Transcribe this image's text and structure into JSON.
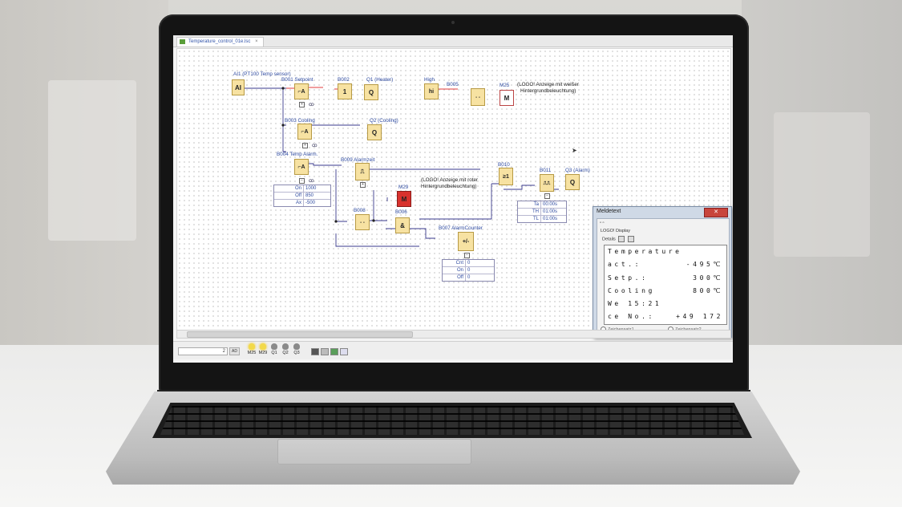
{
  "document_tab": {
    "title": "Temperature_control_01e.lsc",
    "close": "×"
  },
  "blocks": [
    {
      "id": "AI1",
      "glyph": "AI",
      "label": "AI1  (PT100 Temp sensor)"
    },
    {
      "id": "B001",
      "glyph": "⌐A",
      "label": "B001 Setpoint"
    },
    {
      "id": "B002",
      "glyph": "1",
      "label": "B002"
    },
    {
      "id": "Q1",
      "glyph": "Q",
      "label": "Q1  (Heater)"
    },
    {
      "id": "High",
      "glyph": "hi",
      "label": "High"
    },
    {
      "id": "B005",
      "glyph": "- -",
      "label": "B005"
    },
    {
      "id": "M25",
      "glyph": "M",
      "label": "M25"
    },
    {
      "id": "B003",
      "glyph": "⌐A",
      "label": "B003 Cooling"
    },
    {
      "id": "Q2",
      "glyph": "Q",
      "label": "Q2  (Cooling)"
    },
    {
      "id": "B004",
      "glyph": "⌐A",
      "label": "B004 Temp Alarm."
    },
    {
      "id": "B009",
      "glyph": "⎍",
      "label": "B009 Alarmzeit"
    },
    {
      "id": "B010",
      "glyph": "≥1",
      "label": "B010"
    },
    {
      "id": "B011",
      "glyph": "⎍⎍",
      "label": "B011"
    },
    {
      "id": "Q3",
      "glyph": "Q",
      "label": "Q3  (Alarm)"
    },
    {
      "id": "M29",
      "glyph": "M",
      "label": "M29"
    },
    {
      "id": "B008",
      "glyph": "- -",
      "label": "B008"
    },
    {
      "id": "B006",
      "glyph": "&",
      "label": "B006"
    },
    {
      "id": "B007",
      "glyph": "+/-",
      "label": "B007 AlarmCounter"
    }
  ],
  "comments": {
    "m25_line1": "(LOGO! Anzeige mit weißer",
    "m25_line2": "Hintergrundbeleuchtung)",
    "m29_line1": "(LOGO! Anzeige mit roter",
    "m29_line2": "Hintergrundbeleuchtung)"
  },
  "param_tables": {
    "b004": [
      {
        "k": "On",
        "v": "1000"
      },
      {
        "k": "Off",
        "v": "850"
      },
      {
        "k": "Ax",
        "v": "-500"
      }
    ],
    "b011": [
      {
        "k": "Ta",
        "v": "00:00s"
      },
      {
        "k": "TH",
        "v": "01:00s"
      },
      {
        "k": "TL",
        "v": "01:00s"
      }
    ],
    "b007": [
      {
        "k": "Cnt",
        "v": "0"
      },
      {
        "k": "On",
        "v": "0"
      },
      {
        "k": "Off",
        "v": "0"
      }
    ]
  },
  "message_window": {
    "title": "Meldetext",
    "close": "✕",
    "subtitle": "LOGO! Display",
    "details_label": "Details",
    "lines": [
      {
        "left": "Temperature",
        "right": ""
      },
      {
        "left": "act.:",
        "right": "-495℃"
      },
      {
        "left": "Setp.:",
        "right": "300℃"
      },
      {
        "left": "Cooling",
        "right": "800℃"
      },
      {
        "left": "We 15:21",
        "right": ""
      },
      {
        "left": "ce No.:",
        "right": "+49 172"
      }
    ],
    "charset1": "Zeichensatz1",
    "charset2": "Zeichensatz2"
  },
  "status_bar": {
    "sim_value": "2",
    "sim_unit": "AD",
    "lamps": [
      {
        "label": "M25",
        "on": true
      },
      {
        "label": "M29",
        "on": true
      },
      {
        "label": "Q1",
        "on": false
      },
      {
        "label": "Q2",
        "on": false
      },
      {
        "label": "Q3",
        "on": false
      }
    ]
  },
  "colors": {
    "block_fill": "#f7e2a2",
    "active_wire": "#e03c3c",
    "wire": "#3a3a8c",
    "m29_fill": "#d8322e"
  }
}
